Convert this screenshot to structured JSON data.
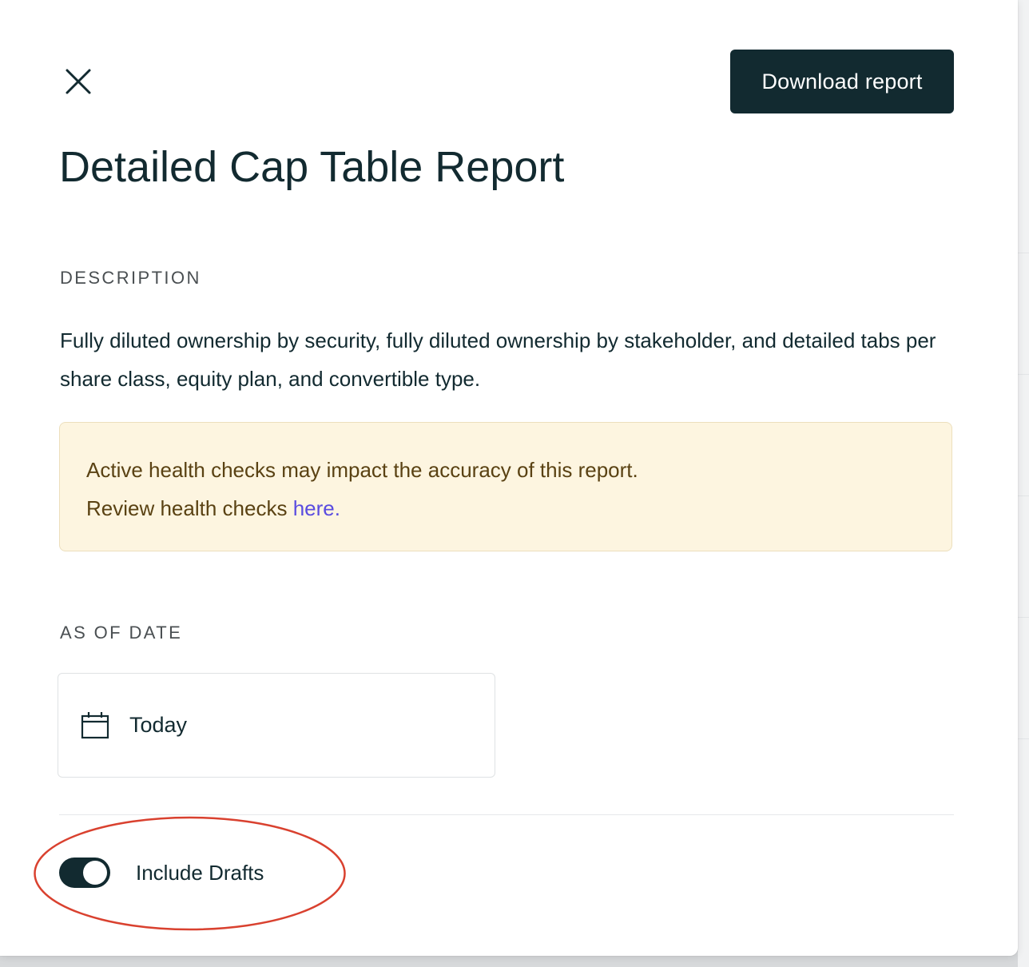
{
  "header": {
    "close_icon": "close-icon",
    "download_label": "Download report"
  },
  "report": {
    "title": "Detailed Cap Table Report"
  },
  "description": {
    "label": "DESCRIPTION",
    "text": "Fully diluted ownership by security, fully diluted ownership by stakeholder, and detailed tabs per share class, equity plan, and convertible type."
  },
  "alert": {
    "line1": "Active health checks may impact the accuracy of this report.",
    "line2_prefix": "Review health checks",
    "link_text": "here.",
    "background": "#fdf5e0",
    "text_color": "#5a4213",
    "link_color": "#5a4ce0"
  },
  "as_of_date": {
    "label": "AS OF DATE",
    "icon": "calendar-icon",
    "value": "Today"
  },
  "drafts": {
    "label": "Include Drafts",
    "enabled": true
  },
  "colors": {
    "primary": "#122a30",
    "annotation": "#d9412f"
  }
}
